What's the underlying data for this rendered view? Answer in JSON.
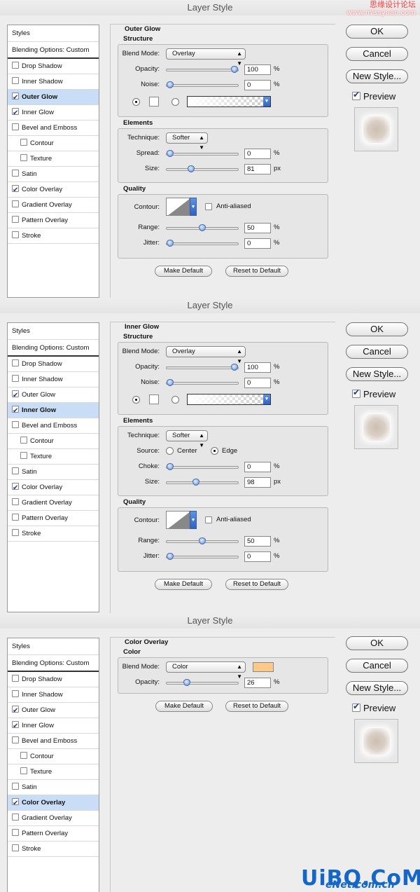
{
  "watermark": {
    "line1": "思缘设计论坛",
    "line2": "www.missyuan.com"
  },
  "logo": {
    "text": "UiBQ.CoM",
    "sub": "eNet.com.cn"
  },
  "dialogs": [
    {
      "title": "Layer Style",
      "section": "Outer Glow",
      "list": [
        {
          "label": "Styles",
          "check": null
        },
        {
          "label": "Blending Options: Custom",
          "check": null
        },
        {
          "label": "Drop Shadow",
          "check": false
        },
        {
          "label": "Inner Shadow",
          "check": false
        },
        {
          "label": "Outer Glow",
          "check": true,
          "sel": true
        },
        {
          "label": "Inner Glow",
          "check": true
        },
        {
          "label": "Bevel and Emboss",
          "check": false
        },
        {
          "label": "Contour",
          "check": false,
          "sub": true
        },
        {
          "label": "Texture",
          "check": false,
          "sub": true
        },
        {
          "label": "Satin",
          "check": false
        },
        {
          "label": "Color Overlay",
          "check": true
        },
        {
          "label": "Gradient Overlay",
          "check": false
        },
        {
          "label": "Pattern Overlay",
          "check": false
        },
        {
          "label": "Stroke",
          "check": false
        }
      ],
      "structure": {
        "title": "Structure",
        "blend_label": "Blend Mode:",
        "blend_mode": "Overlay",
        "opacity_label": "Opacity:",
        "opacity": "100",
        "opacity_pct": 1.0,
        "noise_label": "Noise:",
        "noise": "0",
        "noise_pct": 0.0
      },
      "elements": {
        "title": "Elements",
        "technique_label": "Technique:",
        "technique": "Softer",
        "spread_label": "Spread:",
        "spread": "0",
        "spread_pct": 0.0,
        "size_label": "Size:",
        "size": "81",
        "size_pct": 0.33
      },
      "quality": {
        "title": "Quality",
        "contour_label": "Contour:",
        "anti_label": "Anti-aliased",
        "range_label": "Range:",
        "range": "50",
        "range_pct": 0.5,
        "jitter_label": "Jitter:",
        "jitter": "0",
        "jitter_pct": 0.0
      },
      "make_default": "Make Default",
      "reset_default": "Reset to Default"
    },
    {
      "title": "Layer Style",
      "section": "Inner Glow",
      "list": [
        {
          "label": "Styles",
          "check": null
        },
        {
          "label": "Blending Options: Custom",
          "check": null
        },
        {
          "label": "Drop Shadow",
          "check": false
        },
        {
          "label": "Inner Shadow",
          "check": false
        },
        {
          "label": "Outer Glow",
          "check": true
        },
        {
          "label": "Inner Glow",
          "check": true,
          "sel": true
        },
        {
          "label": "Bevel and Emboss",
          "check": false
        },
        {
          "label": "Contour",
          "check": false,
          "sub": true
        },
        {
          "label": "Texture",
          "check": false,
          "sub": true
        },
        {
          "label": "Satin",
          "check": false
        },
        {
          "label": "Color Overlay",
          "check": true
        },
        {
          "label": "Gradient Overlay",
          "check": false
        },
        {
          "label": "Pattern Overlay",
          "check": false
        },
        {
          "label": "Stroke",
          "check": false
        }
      ],
      "structure": {
        "title": "Structure",
        "blend_label": "Blend Mode:",
        "blend_mode": "Overlay",
        "opacity_label": "Opacity:",
        "opacity": "100",
        "opacity_pct": 1.0,
        "noise_label": "Noise:",
        "noise": "0",
        "noise_pct": 0.0
      },
      "elements": {
        "title": "Elements",
        "technique_label": "Technique:",
        "technique": "Softer",
        "source_label": "Source:",
        "center_label": "Center",
        "edge_label": "Edge",
        "choke_label": "Choke:",
        "choke": "0",
        "choke_pct": 0.0,
        "size_label": "Size:",
        "size": "98",
        "size_pct": 0.4
      },
      "quality": {
        "title": "Quality",
        "contour_label": "Contour:",
        "anti_label": "Anti-aliased",
        "range_label": "Range:",
        "range": "50",
        "range_pct": 0.5,
        "jitter_label": "Jitter:",
        "jitter": "0",
        "jitter_pct": 0.0
      },
      "make_default": "Make Default",
      "reset_default": "Reset to Default"
    },
    {
      "title": "Layer Style",
      "section": "Color Overlay",
      "list": [
        {
          "label": "Styles",
          "check": null
        },
        {
          "label": "Blending Options: Custom",
          "check": null
        },
        {
          "label": "Drop Shadow",
          "check": false
        },
        {
          "label": "Inner Shadow",
          "check": false
        },
        {
          "label": "Outer Glow",
          "check": true
        },
        {
          "label": "Inner Glow",
          "check": true
        },
        {
          "label": "Bevel and Emboss",
          "check": false
        },
        {
          "label": "Contour",
          "check": false,
          "sub": true
        },
        {
          "label": "Texture",
          "check": false,
          "sub": true
        },
        {
          "label": "Satin",
          "check": false
        },
        {
          "label": "Color Overlay",
          "check": true,
          "sel": true
        },
        {
          "label": "Gradient Overlay",
          "check": false
        },
        {
          "label": "Pattern Overlay",
          "check": false
        },
        {
          "label": "Stroke",
          "check": false
        }
      ],
      "color": {
        "title": "Color",
        "blend_label": "Blend Mode:",
        "blend_mode": "Color",
        "swatch": "#fcc98b",
        "opacity_label": "Opacity:",
        "opacity": "26",
        "opacity_pct": 0.26
      },
      "make_default": "Make Default",
      "reset_default": "Reset to Default"
    }
  ],
  "buttons": {
    "ok": "OK",
    "cancel": "Cancel",
    "new_style": "New Style...",
    "preview": "Preview"
  },
  "units": {
    "pct": "%",
    "px": "px"
  }
}
